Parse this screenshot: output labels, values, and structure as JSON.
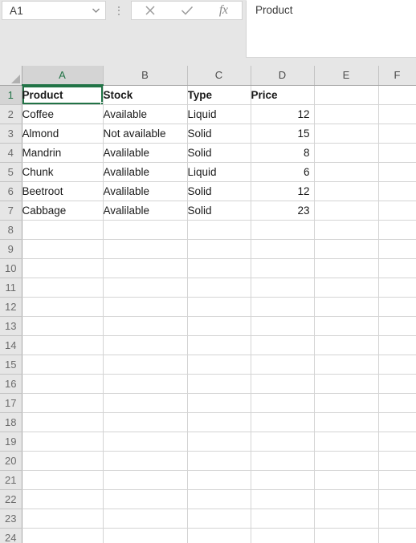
{
  "formula_bar": {
    "name_box_value": "A1",
    "name_box_dropdown_icon": "chevron-down-icon",
    "more_icon": "vertical-ellipsis-icon",
    "cancel_icon": "close-x-icon",
    "confirm_icon": "checkmark-icon",
    "function_icon": "fx-insert-function-icon",
    "function_icon_label": "fx",
    "content": "Product"
  },
  "grid": {
    "select_all_icon": "select-all-triangle-icon",
    "active_cell": "A1",
    "column_headers": [
      "A",
      "B",
      "C",
      "D",
      "E",
      "F"
    ],
    "row_headers": [
      "1",
      "2",
      "3",
      "4",
      "5",
      "6",
      "7",
      "8",
      "9",
      "10",
      "11",
      "12",
      "13",
      "14",
      "15",
      "16",
      "17",
      "18",
      "19",
      "20",
      "21",
      "22",
      "23",
      "24"
    ],
    "header_row": {
      "A": "Product",
      "B": "Stock",
      "C": "Type",
      "D": "Price"
    },
    "rows": [
      {
        "row": "2",
        "product": "Coffee",
        "stock": "Available",
        "type": "Liquid",
        "price": "12"
      },
      {
        "row": "3",
        "product": "Almond",
        "stock": "Not available",
        "type": "Solid",
        "price": "15"
      },
      {
        "row": "4",
        "product": "Mandrin",
        "stock": "Avalilable",
        "type": "Solid",
        "price": "8"
      },
      {
        "row": "5",
        "product": "Chunk",
        "stock": "Avalilable",
        "type": "Liquid",
        "price": "6"
      },
      {
        "row": "6",
        "product": "Beetroot",
        "stock": "Avalilable",
        "type": "Solid",
        "price": "12"
      },
      {
        "row": "7",
        "product": "Cabbage",
        "stock": "Avalilable",
        "type": "Solid",
        "price": "23"
      }
    ],
    "empty_row_numbers": [
      "8",
      "9",
      "10",
      "11",
      "12",
      "13",
      "14",
      "15",
      "16",
      "17",
      "18",
      "19",
      "20",
      "21",
      "22",
      "23",
      "24"
    ]
  },
  "colors": {
    "accent_green": "#217346",
    "toolbar_background": "#e6e6e6",
    "gridline": "#d4d4d4",
    "header_background": "#e6e6e6",
    "active_header_background": "#d4d4d4"
  }
}
